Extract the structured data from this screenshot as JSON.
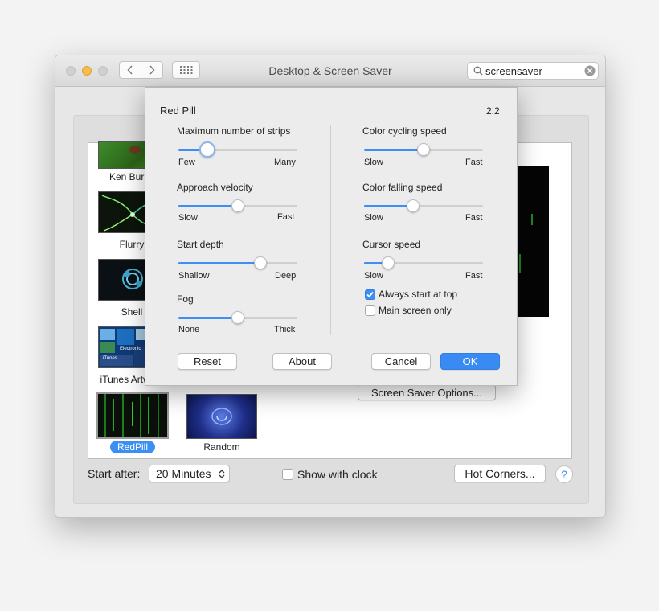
{
  "window": {
    "title": "Desktop & Screen Saver"
  },
  "search": {
    "value": "screensaver"
  },
  "savers": [
    {
      "label": "Ken Burns"
    },
    {
      "label": "Flurry"
    },
    {
      "label": "Shell"
    },
    {
      "label": "iTunes Artwork"
    },
    {
      "label": "RedPill"
    },
    {
      "label": "Random"
    }
  ],
  "itunes_thumb_text": {
    "t1": "iTunes",
    "t2": "Electronic"
  },
  "start_after": {
    "label": "Start after:",
    "value": "20 Minutes"
  },
  "show_clock": {
    "label": "Show with clock",
    "checked": false
  },
  "hot_corners": {
    "label": "Hot Corners..."
  },
  "help": {
    "label": "?"
  },
  "saver_options": {
    "label": "Screen Saver Options..."
  },
  "sheet": {
    "title": "Red Pill",
    "version": "2.2",
    "sliders": [
      {
        "label": "Maximum number of strips",
        "min_label": "Few",
        "max_label": "Many",
        "value": 0.24
      },
      {
        "label": "Approach velocity",
        "min_label": "Slow",
        "max_label": "Fast",
        "value": 0.5
      },
      {
        "label": "Start depth",
        "min_label": "Shallow",
        "max_label": "Deep",
        "value": 0.69
      },
      {
        "label": "Fog",
        "min_label": "None",
        "max_label": "Thick",
        "value": 0.5
      },
      {
        "label": "Color cycling speed",
        "min_label": "Slow",
        "max_label": "Fast",
        "value": 0.5
      },
      {
        "label": "Color falling speed",
        "min_label": "Slow",
        "max_label": "Fast",
        "value": 0.41
      },
      {
        "label": "Cursor speed",
        "min_label": "Slow",
        "max_label": "Fast",
        "value": 0.2
      }
    ],
    "checks": [
      {
        "label": "Always start at top",
        "checked": true
      },
      {
        "label": "Main screen only",
        "checked": false
      }
    ],
    "buttons": {
      "reset": "Reset",
      "about": "About",
      "cancel": "Cancel",
      "ok": "OK"
    }
  },
  "colors": {
    "accent": "#3d8ef5",
    "ok_button": "#3a8af3",
    "close": "#d3d3d3",
    "minimize": "#f5bd4f"
  }
}
